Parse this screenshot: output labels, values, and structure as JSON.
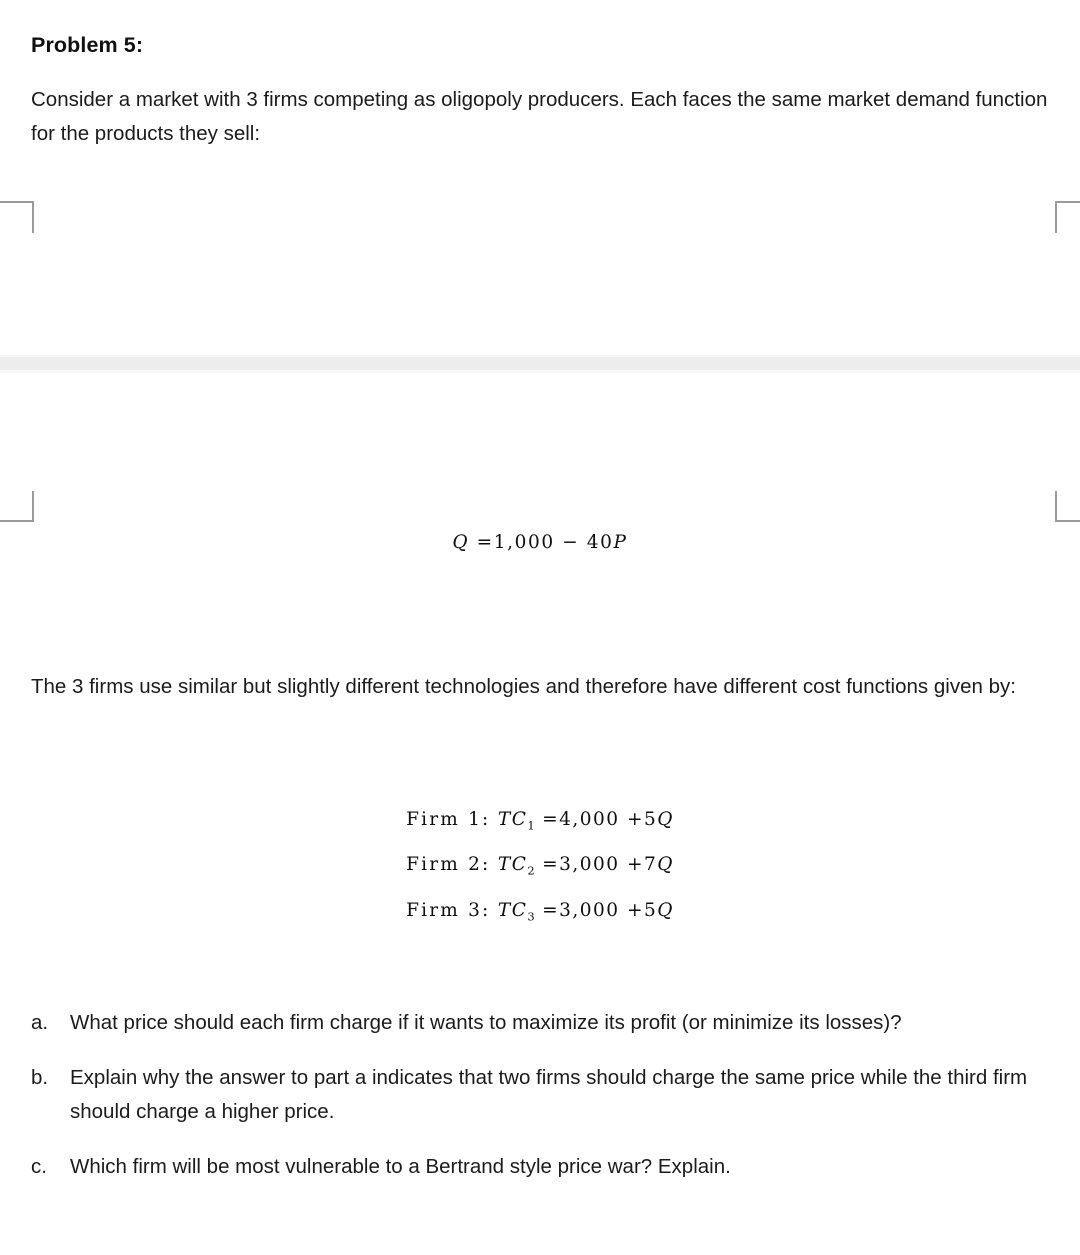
{
  "document": {
    "title": "Problem 5:",
    "intro_paragraph": "Consider a market with 3 firms competing as oligopoly producers. Each faces the same market demand function for the products they sell:",
    "mid_paragraph": "The 3 firms use similar but slightly different technologies and therefore have different cost functions given by:",
    "background_color": "#ffffff",
    "text_color": "#1b1b1b"
  },
  "demand_equation": {
    "lhs": "Q",
    "equals": "=",
    "intercept": "1,000",
    "operator": "−",
    "slope": "40",
    "variable": "P",
    "plain": "Q = 1,000 − 40P"
  },
  "cost_functions": [
    {
      "firm_label": "Firm 1:",
      "symbol": "TC",
      "subscript": "1",
      "equals": "=",
      "fixed_cost": "4,000",
      "operator": "+",
      "marginal_cost": "5",
      "quantity": "Q",
      "plain": "Firm 1: TC₁ = 4,000 + 5Q"
    },
    {
      "firm_label": "Firm 2:",
      "symbol": "TC",
      "subscript": "2",
      "equals": "=",
      "fixed_cost": "3,000",
      "operator": "+",
      "marginal_cost": "7",
      "quantity": "Q",
      "plain": "Firm 2: TC₂ = 3,000 + 7Q"
    },
    {
      "firm_label": "Firm 3:",
      "symbol": "TC",
      "subscript": "3",
      "equals": "=",
      "fixed_cost": "3,000",
      "operator": "+",
      "marginal_cost": "5",
      "quantity": "Q",
      "plain": "Firm 3: TC₃ = 3,000 + 5Q"
    }
  ],
  "questions": [
    {
      "marker": "a.",
      "text": "What price should each firm charge if it wants to maximize its profit (or minimize its losses)?"
    },
    {
      "marker": "b.",
      "text": "Explain why the answer to part a indicates that two firms should charge the same price while the third firm should charge a higher price."
    },
    {
      "marker": "c.",
      "text": "Which firm will be most vulnerable to a Bertrand style price war? Explain."
    }
  ],
  "artifacts": {
    "band_color": "#ededed",
    "crop_mark_color": "#9a9a9a"
  }
}
